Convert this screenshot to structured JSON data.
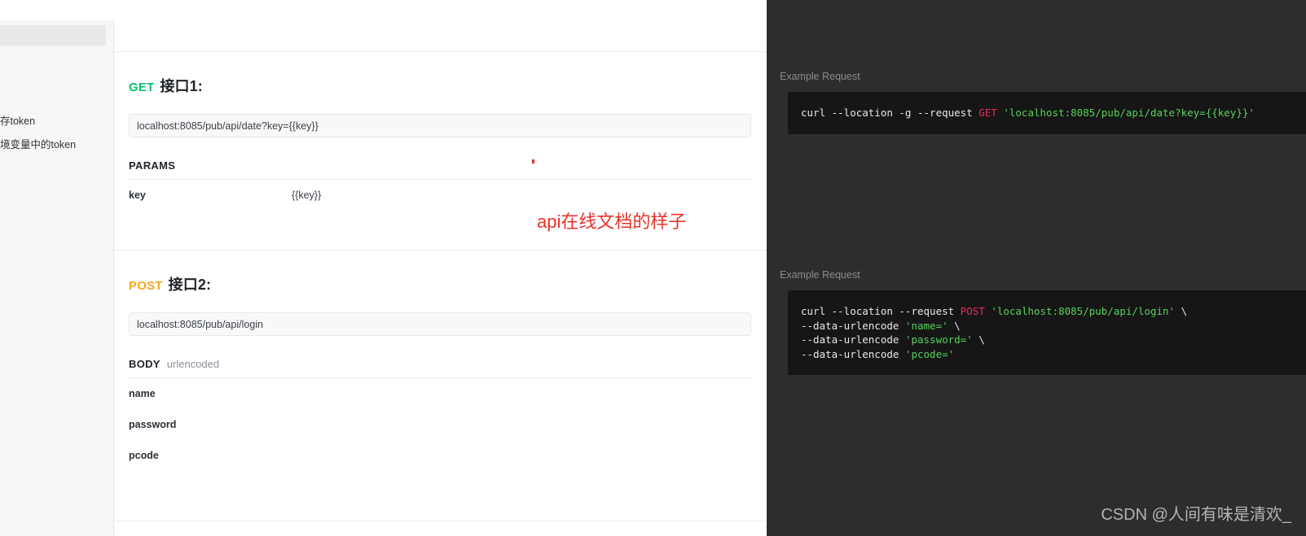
{
  "sidebar": {
    "tree_lines": [
      "存token",
      "境变量中的token"
    ]
  },
  "annotation": {
    "text": "api在线文档的样子",
    "color": "#e8322a"
  },
  "doc": {
    "endpoints": [
      {
        "method": "GET",
        "method_color": "#0ac074",
        "title": "接口1:",
        "url": "localhost:8085/pub/api/date?key={{key}}",
        "section_main": "PARAMS",
        "section_sub": "",
        "rows": [
          {
            "name": "key",
            "value": "{{key}}"
          }
        ]
      },
      {
        "method": "POST",
        "method_color": "#f5a623",
        "title": "接口2:",
        "url": "localhost:8085/pub/api/login",
        "section_main": "BODY",
        "section_sub": "urlencoded",
        "rows": [
          {
            "name": "name",
            "value": ""
          },
          {
            "name": "password",
            "value": ""
          },
          {
            "name": "pcode",
            "value": ""
          }
        ]
      }
    ]
  },
  "example_panel": {
    "blocks": [
      {
        "label": "Example Request",
        "lines": [
          [
            {
              "t": "curl --location -g --request ",
              "k": "cmd"
            },
            {
              "t": "GET",
              "k": "method"
            },
            {
              "t": " ",
              "k": "cmd"
            },
            {
              "t": "'localhost:8085/pub/api/date?key={{key}}'",
              "k": "str"
            }
          ]
        ]
      },
      {
        "label": "Example Request",
        "lines": [
          [
            {
              "t": "curl --location --request ",
              "k": "cmd"
            },
            {
              "t": "POST",
              "k": "method"
            },
            {
              "t": " ",
              "k": "cmd"
            },
            {
              "t": "'localhost:8085/pub/api/login'",
              "k": "str"
            },
            {
              "t": " \\",
              "k": "cont"
            }
          ],
          [
            {
              "t": "--data-urlencode ",
              "k": "cmd"
            },
            {
              "t": "'name='",
              "k": "str"
            },
            {
              "t": " \\",
              "k": "cont"
            }
          ],
          [
            {
              "t": "--data-urlencode ",
              "k": "cmd"
            },
            {
              "t": "'password='",
              "k": "str"
            },
            {
              "t": " \\",
              "k": "cont"
            }
          ],
          [
            {
              "t": "--data-urlencode ",
              "k": "cmd"
            },
            {
              "t": "'pcode='",
              "k": "str"
            }
          ]
        ]
      }
    ]
  },
  "watermark": {
    "text": "CSDN @人间有味是清欢_"
  }
}
